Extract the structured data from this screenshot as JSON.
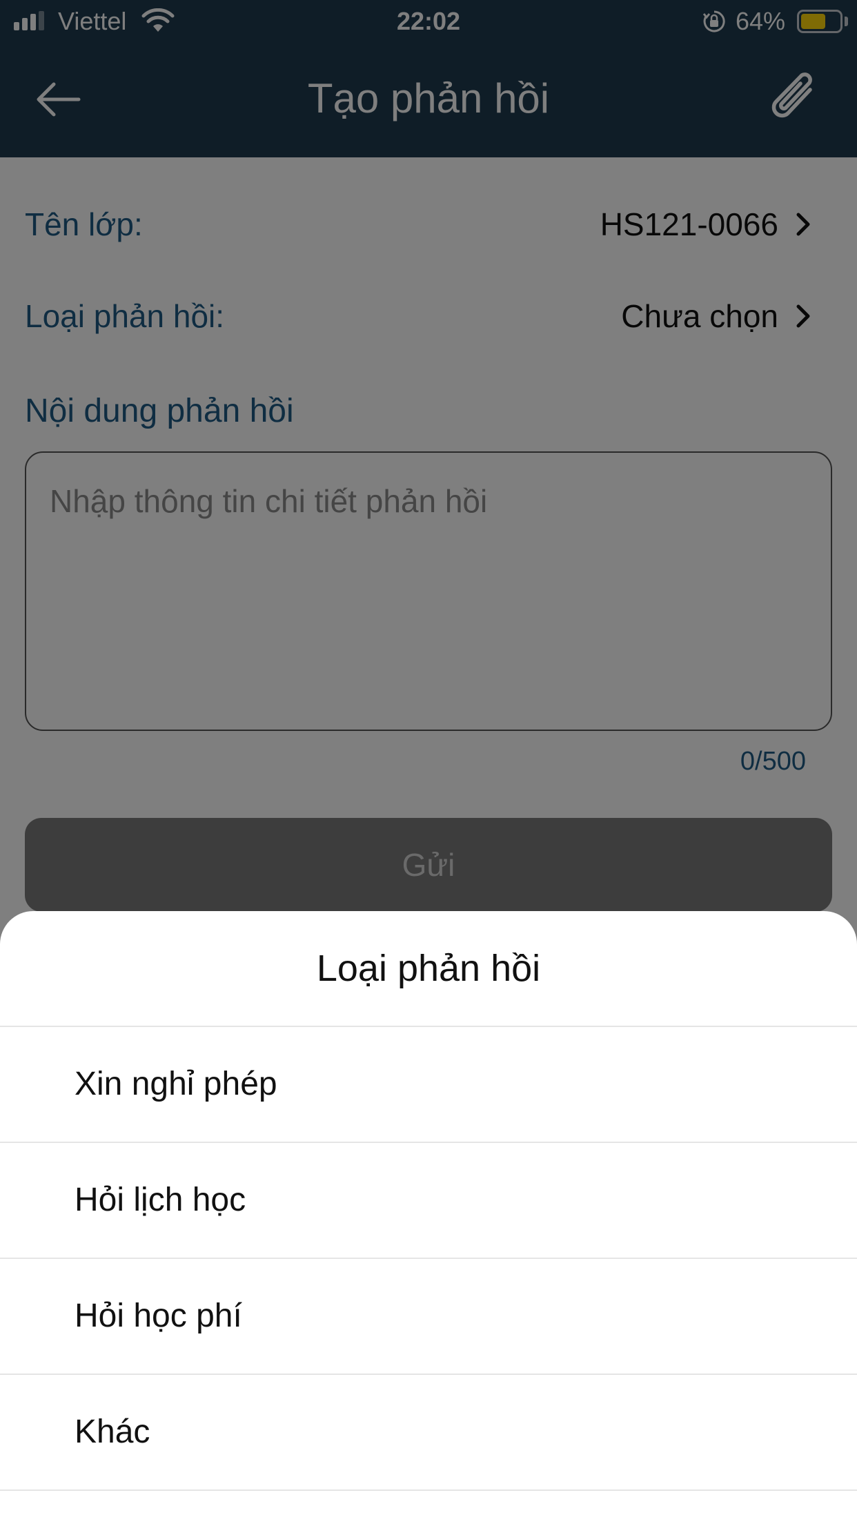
{
  "status_bar": {
    "carrier": "Viettel",
    "time": "22:02",
    "battery_percent": "64%",
    "battery_level": 0.64,
    "signal_bars": 3
  },
  "header": {
    "title": "Tạo phản hồi",
    "back_icon": "arrow-left-icon",
    "attach_icon": "paperclip-icon"
  },
  "form": {
    "class_label": "Tên lớp:",
    "class_value": "HS121-0066",
    "type_label": "Loại phản hồi:",
    "type_value": "Chưa chọn",
    "content_label": "Nội dung phản hồi",
    "content_placeholder": "Nhập thông tin chi tiết phản hồi",
    "content_value": "",
    "char_counter": "0/500",
    "send_label": "Gửi"
  },
  "sheet": {
    "title": "Loại phản hồi",
    "options": [
      {
        "label": "Xin nghỉ phép"
      },
      {
        "label": "Hỏi lịch học"
      },
      {
        "label": "Hỏi học phí"
      },
      {
        "label": "Khác"
      }
    ]
  },
  "colors": {
    "header_bg": "#1f3b4e",
    "label_text": "#1f5b85",
    "battery_fill": "#ffd60a",
    "overlay": "rgba(0,0,0,0.5)"
  }
}
